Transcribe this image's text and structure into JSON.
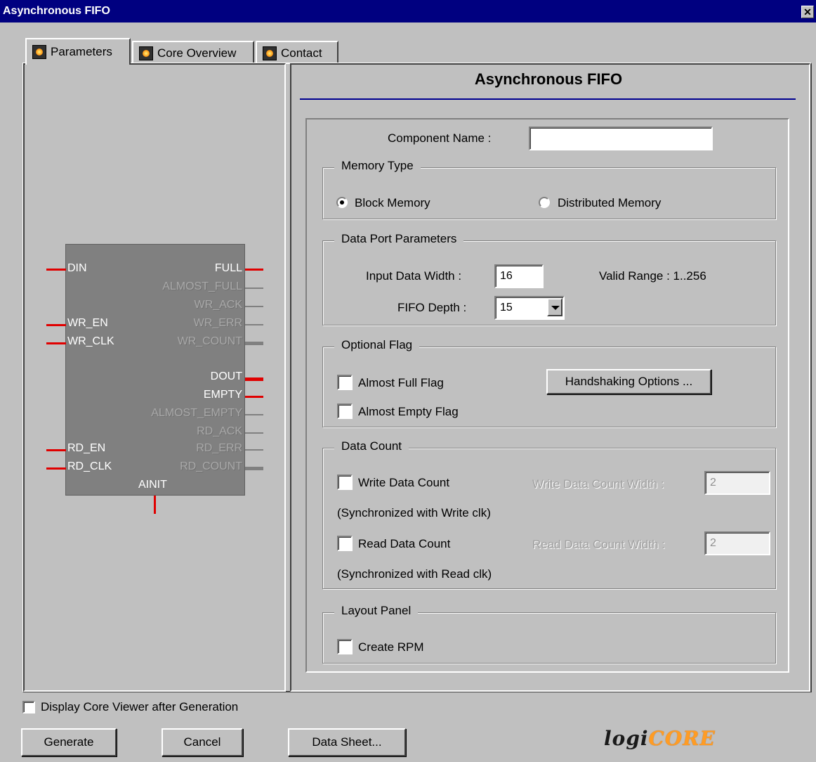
{
  "window": {
    "title": "Asynchronous FIFO",
    "close_glyph": "✕"
  },
  "tabs": [
    {
      "label": "Parameters",
      "icon": "logicore-chip-icon"
    },
    {
      "label": "Core Overview",
      "icon": "logicore-chip-icon"
    },
    {
      "label": "Contact",
      "icon": "logicore-chip-icon"
    }
  ],
  "symbol": {
    "left_pins": [
      "DIN",
      "WR_EN",
      "WR_CLK",
      "RD_EN",
      "RD_CLK"
    ],
    "right_pins_active": [
      "FULL",
      "DOUT",
      "EMPTY"
    ],
    "right_pins_inactive": [
      "ALMOST_FULL",
      "WR_ACK",
      "WR_ERR",
      "WR_COUNT",
      "ALMOST_EMPTY",
      "RD_ACK",
      "RD_ERR",
      "RD_COUNT"
    ],
    "bottom_pin": "AINIT"
  },
  "panel": {
    "title": "Asynchronous FIFO"
  },
  "component_name": {
    "label": "Component Name :",
    "value": ""
  },
  "memory_type": {
    "legend": "Memory Type",
    "block_label": "Block Memory",
    "distributed_label": "Distributed Memory",
    "selected": "Block Memory"
  },
  "data_port": {
    "legend": "Data Port Parameters",
    "input_width_label": "Input Data Width :",
    "input_width_value": "16",
    "valid_range": "Valid Range : 1..256",
    "fifo_depth_label": "FIFO Depth :",
    "fifo_depth_value": "15"
  },
  "optional_flag": {
    "legend": "Optional Flag",
    "almost_full_label": "Almost Full Flag",
    "almost_empty_label": "Almost Empty Flag",
    "handshaking_button": "Handshaking Options ..."
  },
  "data_count": {
    "legend": "Data Count",
    "write_label": "Write Data Count",
    "write_width_label": "Write Data Count Width :",
    "write_width_value": "2",
    "write_sync_note": "(Synchronized with Write clk)",
    "read_label": "Read Data Count",
    "read_width_label": "Read Data Count Width :",
    "read_width_value": "2",
    "read_sync_note": "(Synchronized with Read clk)"
  },
  "layout_panel": {
    "legend": "Layout Panel",
    "create_rpm_label": "Create RPM"
  },
  "footer": {
    "display_viewer_label": "Display Core Viewer after Generation",
    "generate": "Generate",
    "cancel": "Cancel",
    "datasheet": "Data Sheet...",
    "logo_part1": "logi",
    "logo_part2": "CORE"
  },
  "colors": {
    "active_pin_wire": "#e00000",
    "title_bar": "#000080",
    "title_rule": "#000090",
    "logo_accent": "#ff9c24"
  }
}
